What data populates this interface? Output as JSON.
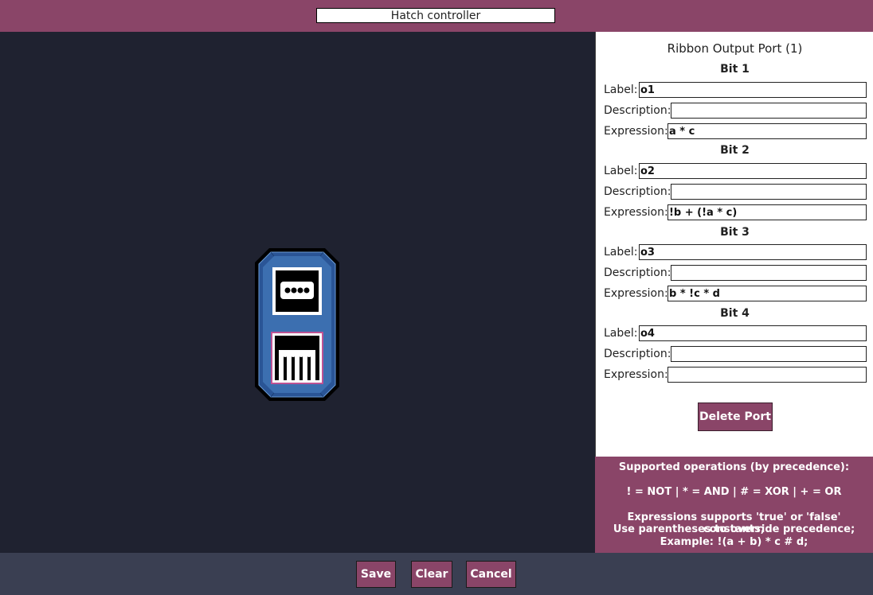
{
  "header": {
    "title_value": "Hatch controller"
  },
  "panel": {
    "title": "Ribbon Output Port (1)",
    "field_labels": {
      "label": "Label:",
      "description": "Description:",
      "expression": "Expression:"
    },
    "bits": [
      {
        "heading": "Bit 1",
        "label": "o1",
        "description": "",
        "expression": "a * c"
      },
      {
        "heading": "Bit 2",
        "label": "o2",
        "description": "",
        "expression": "!b + (!a * c)"
      },
      {
        "heading": "Bit 3",
        "label": "o3",
        "description": "",
        "expression": "b * !c * d"
      },
      {
        "heading": "Bit 4",
        "label": "o4",
        "description": "",
        "expression": ""
      }
    ],
    "delete_label": "Delete Port"
  },
  "help": {
    "line1": "Supported operations (by precedence):",
    "line2": "! = NOT | * = AND | # = XOR | + = OR",
    "line3": "Expressions supports 'true' or 'false' constants;",
    "line4": "Use parentheses to override precedence;",
    "line5": "Example: !(a + b) * c # d;"
  },
  "footer": {
    "save_label": "Save",
    "clear_label": "Clear",
    "cancel_label": "Cancel"
  },
  "colors": {
    "accent": "#8a4568",
    "canvas": "#1f2230",
    "footer": "#3a3f52",
    "device": "#3c6fb0"
  },
  "icons": {
    "port_1": "ribbon-connector-icon",
    "port_2": "ribbon-pins-icon"
  }
}
